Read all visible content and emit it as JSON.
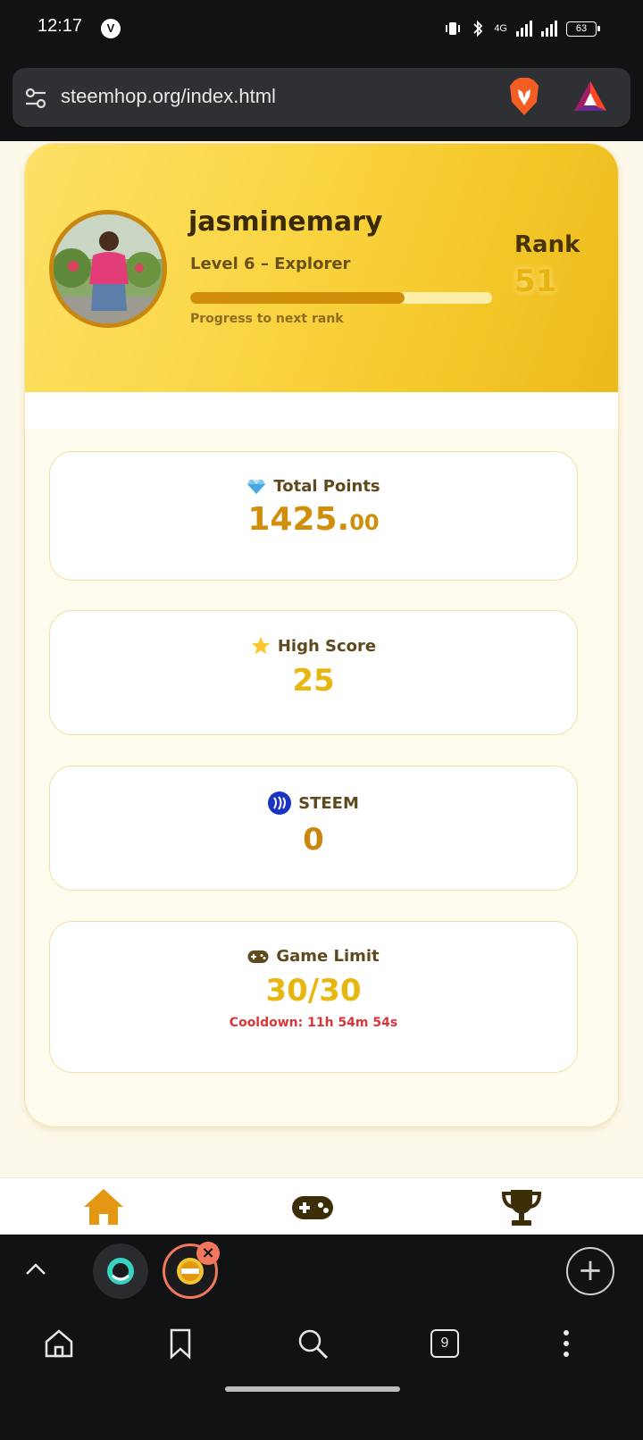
{
  "status_bar": {
    "time": "12:17",
    "vpn_badge": "V",
    "network": "4G",
    "battery": "63"
  },
  "browser": {
    "url": "steemhop.org/index.html",
    "tabs_count": "9"
  },
  "profile": {
    "username": "jasminemary",
    "level": "Level 6 – Explorer",
    "progress_fraction": 0.71,
    "progress_label": "Progress to next rank",
    "rank_label": "Rank",
    "rank_value": "51"
  },
  "stats": {
    "total_points": {
      "title": "Total Points",
      "value_int": "1425.",
      "value_dec": "00",
      "icon": "gem-icon"
    },
    "high_score": {
      "title": "High Score",
      "value": "25",
      "icon": "star-icon"
    },
    "steem": {
      "title": "STEEM",
      "value": "0",
      "icon": "steem-icon"
    },
    "game_limit": {
      "title": "Game Limit",
      "value": "30/30",
      "cooldown": "Cooldown: 11h 54m 54s",
      "icon": "gamepad-icon"
    }
  },
  "app_nav": [
    "home-icon",
    "gamepad-icon",
    "trophy-icon"
  ],
  "colors": {
    "accent": "#d08e0b",
    "gold": "#e8b610",
    "cooldown": "#d8373a",
    "hero_start": "#fde066",
    "hero_end": "#ecb91c"
  }
}
